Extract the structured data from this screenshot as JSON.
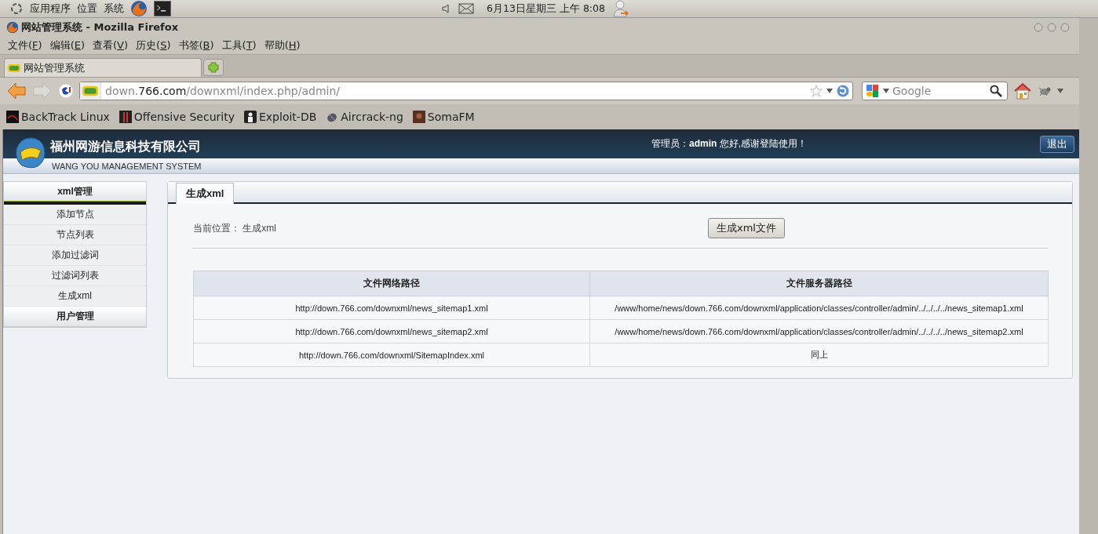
{
  "top_panel": {
    "menus": [
      "应用程序",
      "位置",
      "系统"
    ],
    "clock": "6月13日星期三 上午 8:08"
  },
  "window": {
    "title": "网站管理系统 - Mozilla Firefox"
  },
  "menubar": [
    {
      "before": "文件(",
      "key": "F",
      "after": ")"
    },
    {
      "before": "编辑(",
      "key": "E",
      "after": ")"
    },
    {
      "before": "查看(",
      "key": "V",
      "after": ")"
    },
    {
      "before": "历史(",
      "key": "S",
      "after": ")"
    },
    {
      "before": "书签(",
      "key": "B",
      "after": ")"
    },
    {
      "before": "工具(",
      "key": "T",
      "after": ")"
    },
    {
      "before": "帮助(",
      "key": "H",
      "after": ")"
    }
  ],
  "tabs": [
    {
      "label": "网站管理系统",
      "selected": true
    }
  ],
  "address": {
    "prefix": "down.",
    "domain": "766.com",
    "path": "/downxml/index.php/admin/"
  },
  "search": {
    "placeholder": "Google"
  },
  "bookmarks": [
    "BackTrack Linux",
    "Offensive Security",
    "Exploit-DB",
    "Aircrack-ng",
    "SomaFM"
  ],
  "header": {
    "company": "福州网游信息科技有限公司",
    "subtitle": "WANG YOU MANAGEMENT SYSTEM",
    "greeting": "管理员：**admin** 您好,感谢登陆使用！",
    "logout": "退出"
  },
  "sidebar": [
    {
      "title": "xml管理",
      "expanded": true,
      "items": [
        "添加节点",
        "节点列表",
        "添加过滤词",
        "过滤词列表",
        "生成xml"
      ]
    },
    {
      "title": "用户管理",
      "expanded": false
    }
  ],
  "content": {
    "tab": "生成xml",
    "breadcrumb": "当前位置： 生成xml",
    "action": "生成xml文件",
    "table": {
      "columns": [
        "文件网络路径",
        "文件服务器路径"
      ],
      "rows": [
        [
          "http://down.766.com/downxml/news_sitemap1.xml",
          "/www/home/news/down.766.com/downxml/application/classes/controller/admin/../../../../news_sitemap1.xml"
        ],
        [
          "http://down.766.com/downxml/news_sitemap2.xml",
          "/www/home/news/down.766.com/downxml/application/classes/controller/admin/../../../../news_sitemap2.xml"
        ],
        [
          "http://down.766.com/downxml/SitemapIndex.xml",
          "同上"
        ]
      ]
    }
  }
}
